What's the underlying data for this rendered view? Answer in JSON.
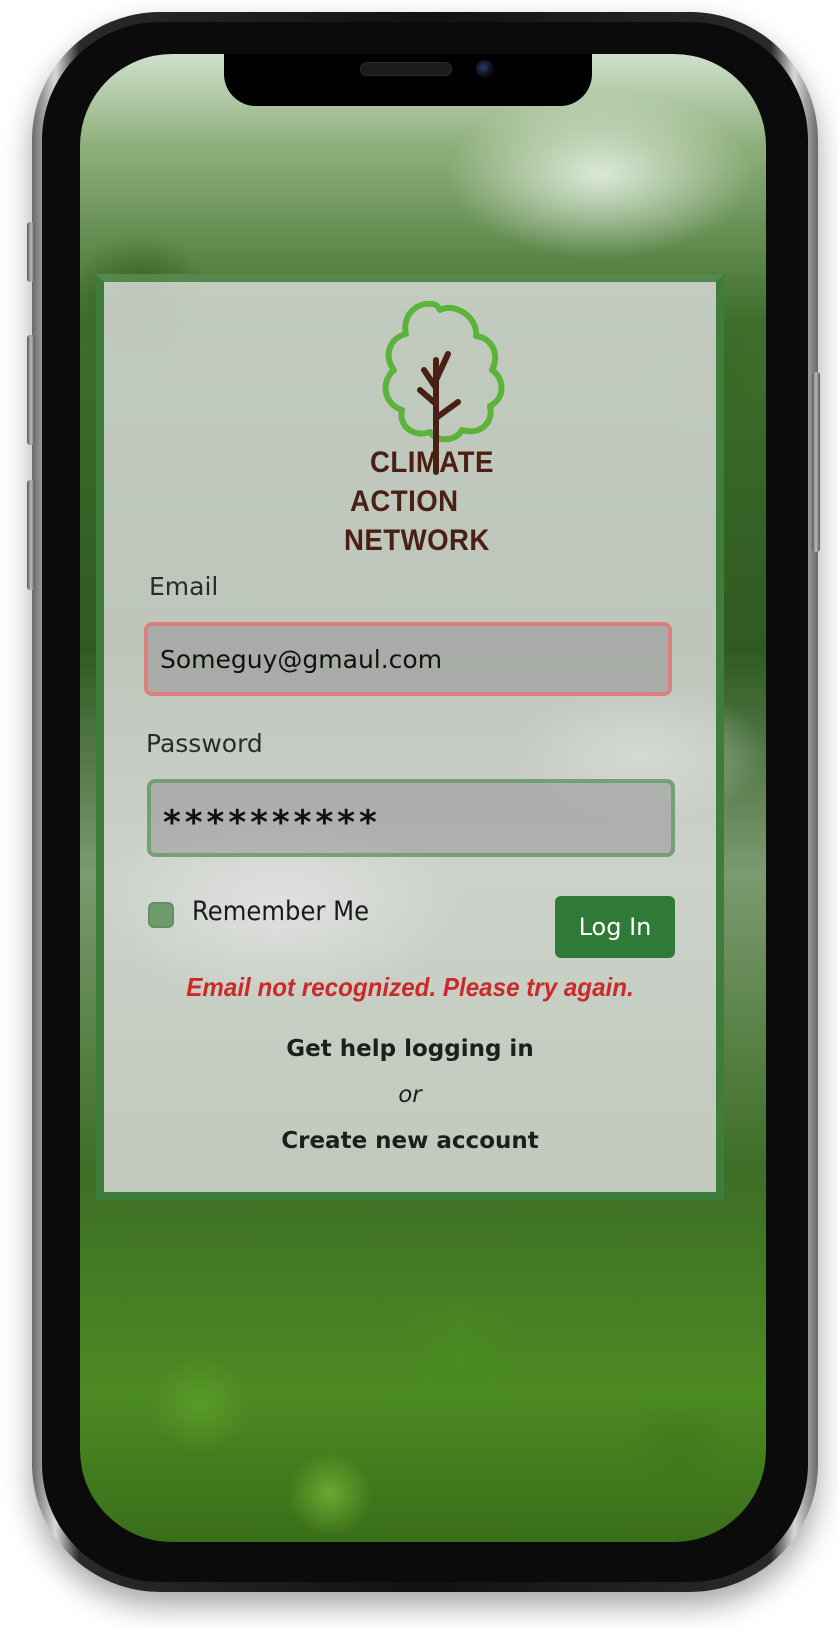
{
  "app": {
    "logo_text": [
      "CLIMATE",
      "ACTION",
      "NETWORK"
    ]
  },
  "login": {
    "email_label": "Email",
    "email_value": "Someguy@gmaul.com",
    "password_label": "Password",
    "password_value": "**********",
    "remember_label": "Remember Me",
    "remember_checked": false,
    "login_button": "Log In",
    "error_message": "Email not recognized. Please try again.",
    "help_link": "Get help logging in",
    "or_text": "or",
    "create_link": "Create new account"
  },
  "colors": {
    "accent": "#2f7a36",
    "card_border": "#3f7d3a",
    "error": "#cc2a2a",
    "logo_text": "#4a2014",
    "logo_leaves": "#5cb33a",
    "email_field_border": "#e47878",
    "password_field_border": "#50964f"
  },
  "icons": {
    "logo": "tree-icon",
    "checkbox": "checkbox-icon"
  }
}
